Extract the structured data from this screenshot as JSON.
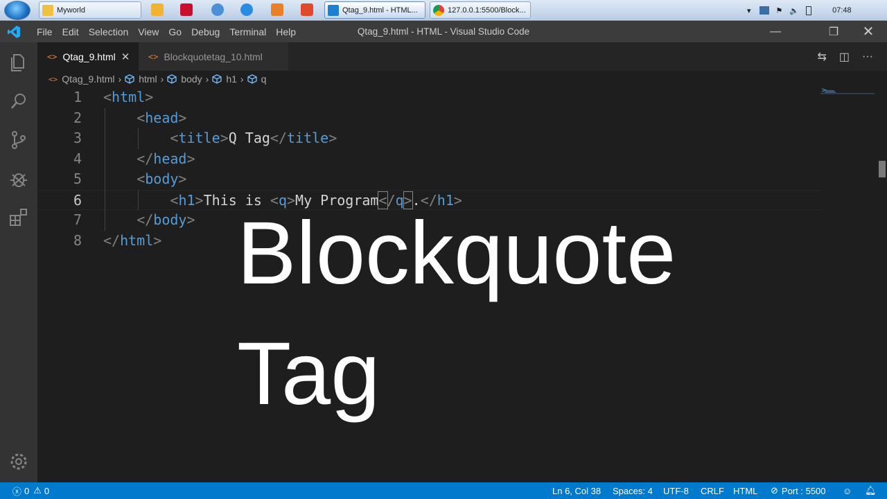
{
  "taskbar": {
    "tasks": [
      {
        "label": "Myworld"
      },
      {
        "label": "Qtag_9.html - HTML..."
      },
      {
        "label": "127.0.0.1:5500/Block..."
      }
    ],
    "clock": "07:48"
  },
  "window": {
    "title": "Qtag_9.html - HTML - Visual Studio Code",
    "menu": [
      "File",
      "Edit",
      "Selection",
      "View",
      "Go",
      "Debug",
      "Terminal",
      "Help"
    ]
  },
  "tabs": [
    {
      "label": "Qtag_9.html",
      "active": true
    },
    {
      "label": "Blockquotetag_10.html",
      "active": false
    }
  ],
  "breadcrumb": [
    "Qtag_9.html",
    "html",
    "body",
    "h1",
    "q"
  ],
  "editor": {
    "lines": [
      {
        "num": "1",
        "tokens": [
          [
            "br",
            "<"
          ],
          [
            "tag",
            "html"
          ],
          [
            "br",
            ">"
          ]
        ]
      },
      {
        "num": "2",
        "tokens": [
          [
            "br",
            "<"
          ],
          [
            "tag",
            "head"
          ],
          [
            "br",
            ">"
          ]
        ]
      },
      {
        "num": "3",
        "tokens": [
          [
            "br",
            "<"
          ],
          [
            "tag",
            "title"
          ],
          [
            "br",
            ">"
          ],
          [
            "txt",
            "Q Tag"
          ],
          [
            "br",
            "</"
          ],
          [
            "tag",
            "title"
          ],
          [
            "br",
            ">"
          ]
        ]
      },
      {
        "num": "4",
        "tokens": [
          [
            "br",
            "</"
          ],
          [
            "tag",
            "head"
          ],
          [
            "br",
            ">"
          ]
        ]
      },
      {
        "num": "5",
        "tokens": [
          [
            "br",
            "<"
          ],
          [
            "tag",
            "body"
          ],
          [
            "br",
            ">"
          ]
        ]
      },
      {
        "num": "6",
        "tokens": [
          [
            "br",
            "<"
          ],
          [
            "tag",
            "h1"
          ],
          [
            "br",
            ">"
          ],
          [
            "txt",
            "This is "
          ],
          [
            "br",
            "<"
          ],
          [
            "tag",
            "q"
          ],
          [
            "br",
            ">"
          ],
          [
            "txt",
            "My Program"
          ],
          [
            "brh",
            "<"
          ],
          [
            "br",
            "/"
          ],
          [
            "tag",
            "q"
          ],
          [
            "brh",
            ">"
          ],
          [
            "txt",
            "."
          ],
          [
            "br",
            "</"
          ],
          [
            "tag",
            "h1"
          ],
          [
            "br",
            ">"
          ]
        ]
      },
      {
        "num": "7",
        "tokens": [
          [
            "br",
            "</"
          ],
          [
            "tag",
            "body"
          ],
          [
            "br",
            ">"
          ]
        ]
      },
      {
        "num": "8",
        "tokens": [
          [
            "br",
            "</"
          ],
          [
            "tag",
            "html"
          ],
          [
            "br",
            ">"
          ]
        ]
      }
    ],
    "overlay": {
      "line1": "Blockquote",
      "line2": "Tag"
    }
  },
  "status": {
    "errors": "0",
    "warnings": "0",
    "position": "Ln 6, Col 38",
    "spaces": "Spaces: 4",
    "encoding": "UTF-8",
    "eol": "CRLF",
    "language": "HTML",
    "port": "Port : 5500"
  },
  "colors": {
    "statusbar": "#007acc",
    "tag": "#569cd6",
    "bracket": "#808080",
    "text": "#d4d4d4"
  }
}
